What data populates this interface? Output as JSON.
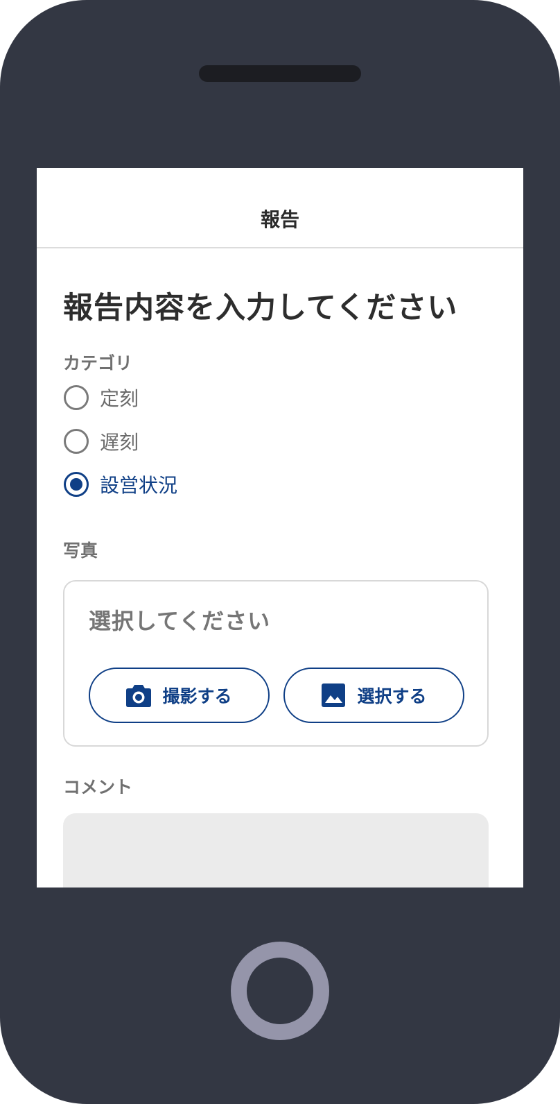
{
  "header": {
    "title": "報告"
  },
  "form": {
    "title": "報告内容を入力してください",
    "category": {
      "label": "カテゴリ",
      "options": [
        {
          "label": "定刻",
          "selected": false
        },
        {
          "label": "遅刻",
          "selected": false
        },
        {
          "label": "設営状況",
          "selected": true
        }
      ]
    },
    "photo": {
      "label": "写真",
      "placeholder": "選択してください",
      "camera_button": "撮影する",
      "gallery_button": "選択する"
    },
    "comment": {
      "label": "コメント",
      "value": ""
    }
  },
  "colors": {
    "device_body": "#333743",
    "accent": "#0f3f86",
    "home_button_ring": "#9595aa"
  },
  "icons": {
    "camera_button_icon": "camera-icon",
    "gallery_button_icon": "image-icon"
  }
}
